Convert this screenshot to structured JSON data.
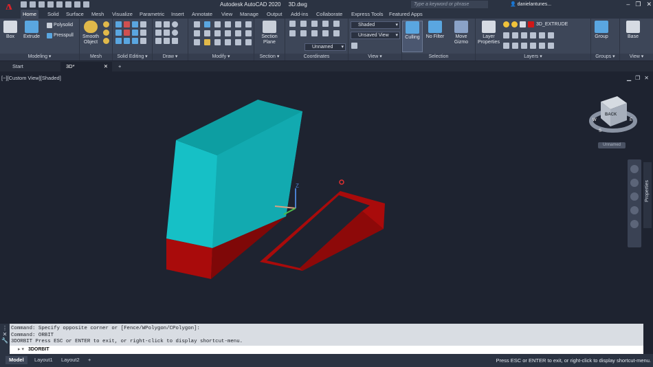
{
  "app": {
    "title": "Autodesk AutoCAD 2020",
    "file": "3D.dwg",
    "logo": "A",
    "search_placeholder": "Type a keyword or phrase",
    "user": "danielantunes...",
    "window_buttons": [
      "–",
      "❐",
      "✕"
    ]
  },
  "ribbon_tabs": [
    "Home",
    "Solid",
    "Surface",
    "Mesh",
    "Visualize",
    "Parametric",
    "Insert",
    "Annotate",
    "View",
    "Manage",
    "Output",
    "Add-ins",
    "Collaborate",
    "Express Tools",
    "Featured Apps"
  ],
  "ribbon": {
    "modeling": {
      "title": "Modeling ▾",
      "box": "Box",
      "extrude": "Extrude",
      "polysolid": "Polysolid",
      "presspull": "Presspull"
    },
    "mesh": {
      "title": "Mesh",
      "smooth_object_1": "Smooth",
      "smooth_object_2": "Object"
    },
    "solid_editing": {
      "title": "Solid Editing ▾"
    },
    "draw": {
      "title": "Draw ▾"
    },
    "modify": {
      "title": "Modify ▾"
    },
    "section": {
      "title": "Section ▾",
      "section_plane_1": "Section",
      "section_plane_2": "Plane"
    },
    "coordinates": {
      "title": "Coordinates",
      "ucs_combo": "Unnamed"
    },
    "view": {
      "title": "View ▾",
      "visual_style": "Shaded",
      "named_view": "Unsaved View"
    },
    "selection": {
      "title": "Selection",
      "culling": "Culling",
      "no_filter_1": "No Filter",
      "move_gizmo_1": "Move",
      "move_gizmo_2": "Gizmo"
    },
    "layers": {
      "title": "Layers ▾",
      "layer_props_1": "Layer",
      "layer_props_2": "Properties",
      "current_layer": "3D_EXTRUDE",
      "layer_color": "#d01818"
    },
    "groups": {
      "title": "Groups ▾",
      "group": "Group"
    },
    "view2": {
      "title": "View ▾",
      "base": "Base"
    }
  },
  "file_tabs": [
    "Start",
    "3D*"
  ],
  "viewport": {
    "label": "[−][Custom View][Shaded]",
    "viewcube_face": "BACK",
    "viewcube_compass": [
      "S",
      "W",
      "E"
    ],
    "ucs_name": "Unnamed",
    "axis_z": "Z",
    "properties_tab": "Properties",
    "colors": {
      "cyan_solid": "#17b0b5",
      "red_solid": "#a90b0b",
      "background": "#1e2330"
    }
  },
  "command": {
    "history": [
      "Command: Specify opposite corner or [Fence/WPolygon/CPolygon]:",
      "Command: ORBIT",
      "3DORBIT Press ESC or ENTER to exit, or right-click to display shortcut-menu."
    ],
    "input": "3DORBIT"
  },
  "status": {
    "layout_tabs": [
      "Model",
      "Layout1",
      "Layout2"
    ],
    "add": "+",
    "message": "Press ESC or ENTER to exit, or right-click to display shortcut-menu."
  }
}
